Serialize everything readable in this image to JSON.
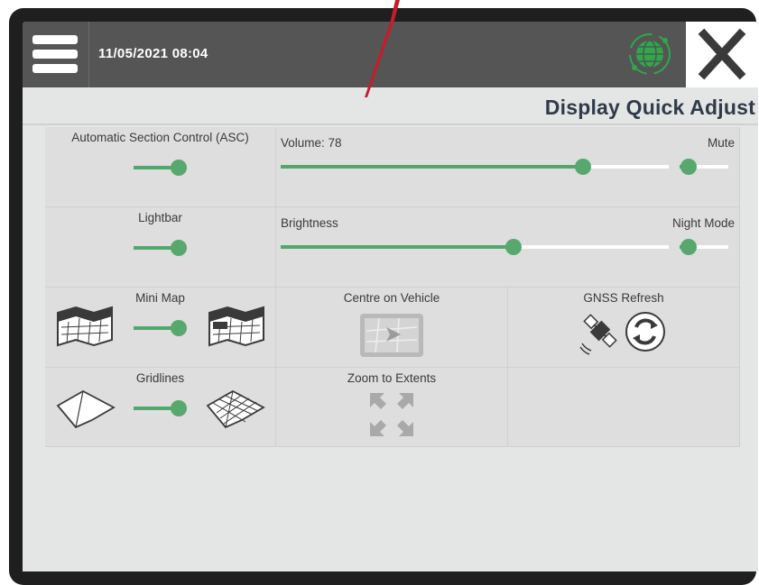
{
  "header": {
    "datetime": "11/05/2021 08:04",
    "gnss_status_icon": "globe-satellite-icon",
    "accent": "#2ea84a"
  },
  "page": {
    "title": "Display Quick Adjust"
  },
  "controls": {
    "asc": {
      "label": "Automatic Section Control (ASC)",
      "on": true
    },
    "volume": {
      "label": "Volume: 78",
      "value": 78,
      "max": 100
    },
    "mute": {
      "label": "Mute",
      "on": false
    },
    "lightbar": {
      "label": "Lightbar",
      "on": true
    },
    "brightness": {
      "label": "Brightness",
      "value": 60,
      "max": 100
    },
    "night_mode": {
      "label": "Night Mode",
      "on": false
    },
    "mini_map": {
      "label": "Mini Map",
      "on": true
    },
    "centre_on_vehicle": {
      "label": "Centre on Vehicle"
    },
    "gnss_refresh": {
      "label": "GNSS Refresh"
    },
    "gridlines": {
      "label": "Gridlines",
      "on": true
    },
    "zoom_to_extents": {
      "label": "Zoom to Extents"
    }
  },
  "colors": {
    "toggle_on": "#56a86c",
    "topbar": "#555555",
    "title": "#2f3b4a"
  }
}
